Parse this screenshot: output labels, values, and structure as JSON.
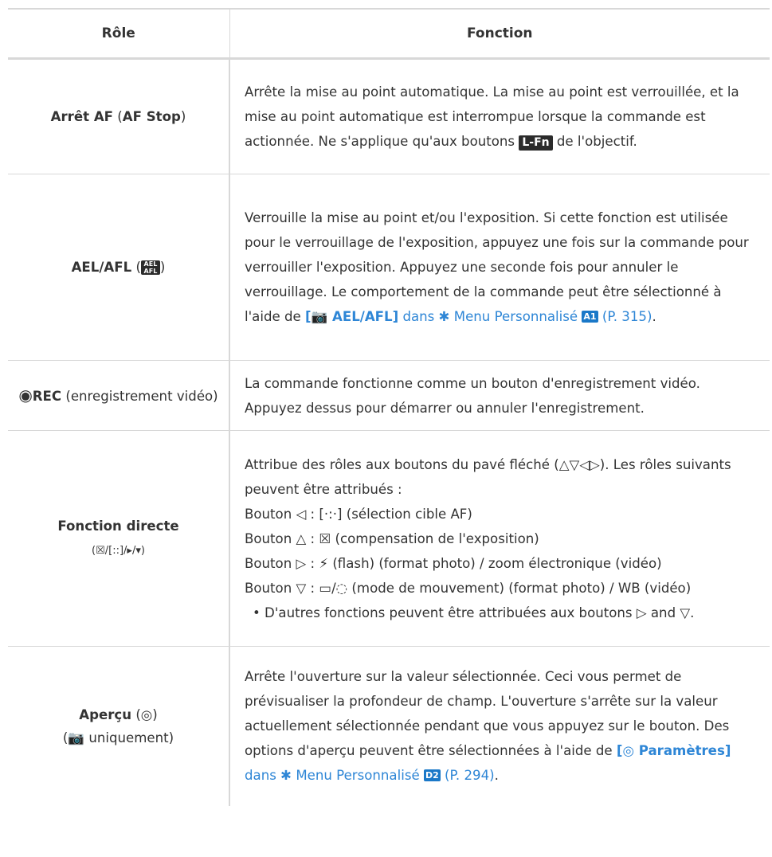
{
  "header": {
    "role": "Rôle",
    "function": "Fonction"
  },
  "rows": [
    {
      "role": {
        "prefix": "",
        "bold": "Arrêt AF",
        "mid": " (",
        "bold2": "AF Stop",
        "suffix": ")"
      },
      "func": {
        "text1": "Arrête la mise au point automatique. La mise au point est verrouillée, et la mise au point automatique est interrompue lorsque la commande est actionnée. Ne s'applique qu'aux boutons ",
        "badge": "L-Fn",
        "text2": " de l'objectif."
      }
    },
    {
      "role": {
        "bold": "AEL/AFL",
        "mid": " (",
        "badge": "AEL AFL",
        "suffix": ")"
      },
      "func": {
        "text1": "Verrouille la mise au point et/ou l'exposition. Si cette fonction est utilisée pour le verrouillage de l'exposition, appuyez une fois sur la commande pour verrouiller l'exposition. Appuyez une seconde fois pour annuler le verrouillage. Le comportement de la commande peut être sélectionné à l'aide de ",
        "link_bold": "[📷 AEL/AFL]",
        "link_text": " dans ✱ Menu Personnalisé ",
        "link_badge": "A1",
        "link_page": " (P. 315)",
        "end": "."
      }
    },
    {
      "role": {
        "icon": "◉",
        "bold": "REC",
        "suffix": " (enregistrement vidéo)"
      },
      "func": {
        "text1": "La commande fonctionne comme un bouton d'enregistrement vidéo. Appuyez dessus pour démarrer ou annuler l'enregistrement."
      }
    },
    {
      "role": {
        "bold": "Fonction directe",
        "line2": "(☒/[::]/▸/▾)"
      },
      "func": {
        "intro": "Attribue des rôles aux boutons du pavé fléché (△▽◁▷). Les rôles suivants peuvent être attribués :",
        "l1": "Bouton ◁ : [·:·] (sélection cible AF)",
        "l2": "Bouton △ : ☒ (compensation de l'exposition)",
        "l3": "Bouton ▷ : ⚡ (flash) (format photo) / zoom électronique (vidéo)",
        "l4": "Bouton ▽ : ▭/◌ (mode de mouvement) (format photo) / WB (vidéo)",
        "bullet": "• D'autres fonctions peuvent être attribuées aux boutons ▷ and ▽."
      }
    },
    {
      "role": {
        "bold": "Aperçu",
        "mid": " (◎)",
        "line2": "(📷 uniquement)"
      },
      "func": {
        "text1": "Arrête l'ouverture sur la valeur sélectionnée. Ceci vous permet de prévisualiser la profondeur de champ. L'ouverture s'arrête sur la valeur actuellement sélectionnée pendant que vous appuyez sur le bouton. Des options d'aperçu peuvent être sélectionnées à l'aide de ",
        "link_bold": "[◎ Paramètres]",
        "link_text": " dans ✱ Menu Personnalisé ",
        "link_badge": "D2",
        "link_page": " (P. 294)",
        "end": "."
      }
    }
  ]
}
